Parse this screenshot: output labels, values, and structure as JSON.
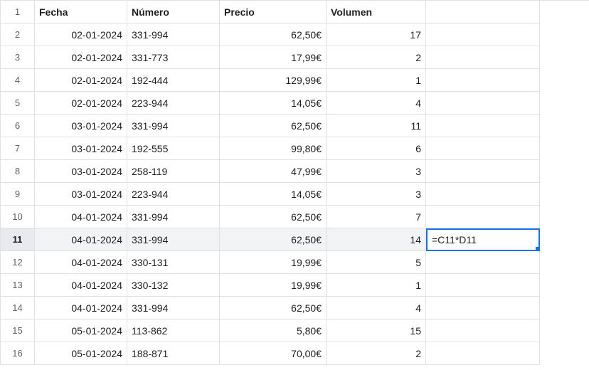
{
  "headers": {
    "fecha": "Fecha",
    "numero": "Número",
    "precio": "Precio",
    "volumen": "Volumen"
  },
  "row_numbers": [
    "1",
    "2",
    "3",
    "4",
    "5",
    "6",
    "7",
    "8",
    "9",
    "10",
    "11",
    "12",
    "13",
    "14",
    "15",
    "16"
  ],
  "rows": [
    {
      "fecha": "02-01-2024",
      "numero": "331-994",
      "precio": "62,50€",
      "volumen": "17"
    },
    {
      "fecha": "02-01-2024",
      "numero": "331-773",
      "precio": "17,99€",
      "volumen": "2"
    },
    {
      "fecha": "02-01-2024",
      "numero": "192-444",
      "precio": "129,99€",
      "volumen": "1"
    },
    {
      "fecha": "02-01-2024",
      "numero": "223-944",
      "precio": "14,05€",
      "volumen": "4"
    },
    {
      "fecha": "03-01-2024",
      "numero": "331-994",
      "precio": "62,50€",
      "volumen": "11"
    },
    {
      "fecha": "03-01-2024",
      "numero": "192-555",
      "precio": "99,80€",
      "volumen": "6"
    },
    {
      "fecha": "03-01-2024",
      "numero": "258-119",
      "precio": "47,99€",
      "volumen": "3"
    },
    {
      "fecha": "03-01-2024",
      "numero": "223-944",
      "precio": "14,05€",
      "volumen": "3"
    },
    {
      "fecha": "04-01-2024",
      "numero": "331-994",
      "precio": "62,50€",
      "volumen": "7"
    },
    {
      "fecha": "04-01-2024",
      "numero": "331-994",
      "precio": "62,50€",
      "volumen": "14"
    },
    {
      "fecha": "04-01-2024",
      "numero": "330-131",
      "precio": "19,99€",
      "volumen": "5"
    },
    {
      "fecha": "04-01-2024",
      "numero": "330-132",
      "precio": "19,99€",
      "volumen": "1"
    },
    {
      "fecha": "04-01-2024",
      "numero": "331-994",
      "precio": "62,50€",
      "volumen": "4"
    },
    {
      "fecha": "05-01-2024",
      "numero": "113-862",
      "precio": "5,80€",
      "volumen": "15"
    },
    {
      "fecha": "05-01-2024",
      "numero": "188-871",
      "precio": "70,00€",
      "volumen": "2"
    }
  ],
  "formula": "=C11*D11",
  "selected_row": "11"
}
